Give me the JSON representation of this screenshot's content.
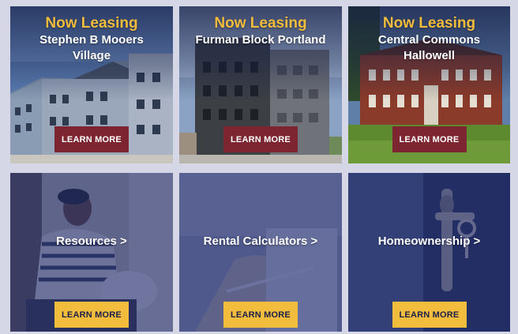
{
  "properties": [
    {
      "eyebrow": "Now Leasing",
      "name_line1": "Stephen B Mooers",
      "name_line2": "Village",
      "cta": "LEARN MORE"
    },
    {
      "eyebrow": "Now Leasing",
      "name_line1": "Furman Block Portland",
      "name_line2": "",
      "cta": "LEARN MORE"
    },
    {
      "eyebrow": "Now Leasing",
      "name_line1": "Central Commons",
      "name_line2": "Hallowell",
      "cta": "LEARN MORE"
    }
  ],
  "links": [
    {
      "title": "Resources >",
      "cta": "LEARN MORE"
    },
    {
      "title": "Rental Calculators >",
      "cta": "LEARN MORE"
    },
    {
      "title": "Homeownership >",
      "cta": "LEARN MORE"
    }
  ],
  "colors": {
    "accent_gold": "#f2bc3c",
    "cta_red": "#7d2530",
    "overlay_navy": "#1e2a6e",
    "page_background": "#d6d7e6"
  }
}
